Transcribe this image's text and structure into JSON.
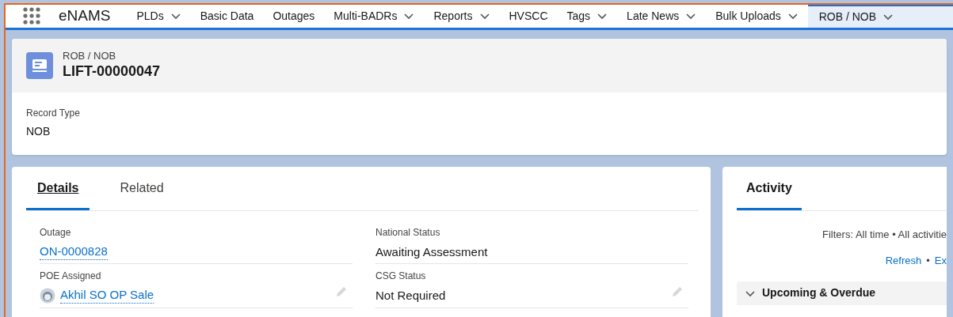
{
  "app": {
    "name": "eNAMS"
  },
  "nav": [
    {
      "label": "PLDs",
      "dropdown": true,
      "selected": false
    },
    {
      "label": "Basic Data",
      "dropdown": false,
      "selected": false
    },
    {
      "label": "Outages",
      "dropdown": false,
      "selected": false
    },
    {
      "label": "Multi-BADRs",
      "dropdown": true,
      "selected": false
    },
    {
      "label": "Reports",
      "dropdown": true,
      "selected": false
    },
    {
      "label": "HVSCC",
      "dropdown": false,
      "selected": false
    },
    {
      "label": "Tags",
      "dropdown": true,
      "selected": false
    },
    {
      "label": "Late News",
      "dropdown": true,
      "selected": false
    },
    {
      "label": "Bulk Uploads",
      "dropdown": true,
      "selected": false
    },
    {
      "label": "ROB / NOB",
      "dropdown": true,
      "selected": true
    }
  ],
  "record": {
    "object": "ROB / NOB",
    "name": "LIFT-00000047",
    "record_type_label": "Record Type",
    "record_type": "NOB"
  },
  "detail_tabs": [
    {
      "label": "Details",
      "selected": true
    },
    {
      "label": "Related",
      "selected": false
    }
  ],
  "fields": [
    {
      "label": "Outage",
      "value": "ON-0000828",
      "kind": "link",
      "editable": false
    },
    {
      "label": "National Status",
      "value": "Awaiting Assessment",
      "kind": "text",
      "editable": false
    },
    {
      "label": "POE Assigned",
      "value": "Akhil SO OP Sale",
      "kind": "user",
      "editable": true
    },
    {
      "label": "CSG Status",
      "value": "Not Required",
      "kind": "text",
      "editable": true
    }
  ],
  "activity": {
    "tab": "Activity",
    "filters": "Filters: All time • All activitie",
    "refresh": "Refresh",
    "separator": "•",
    "export_partial": "Ex",
    "section": "Upcoming & Overdue"
  }
}
